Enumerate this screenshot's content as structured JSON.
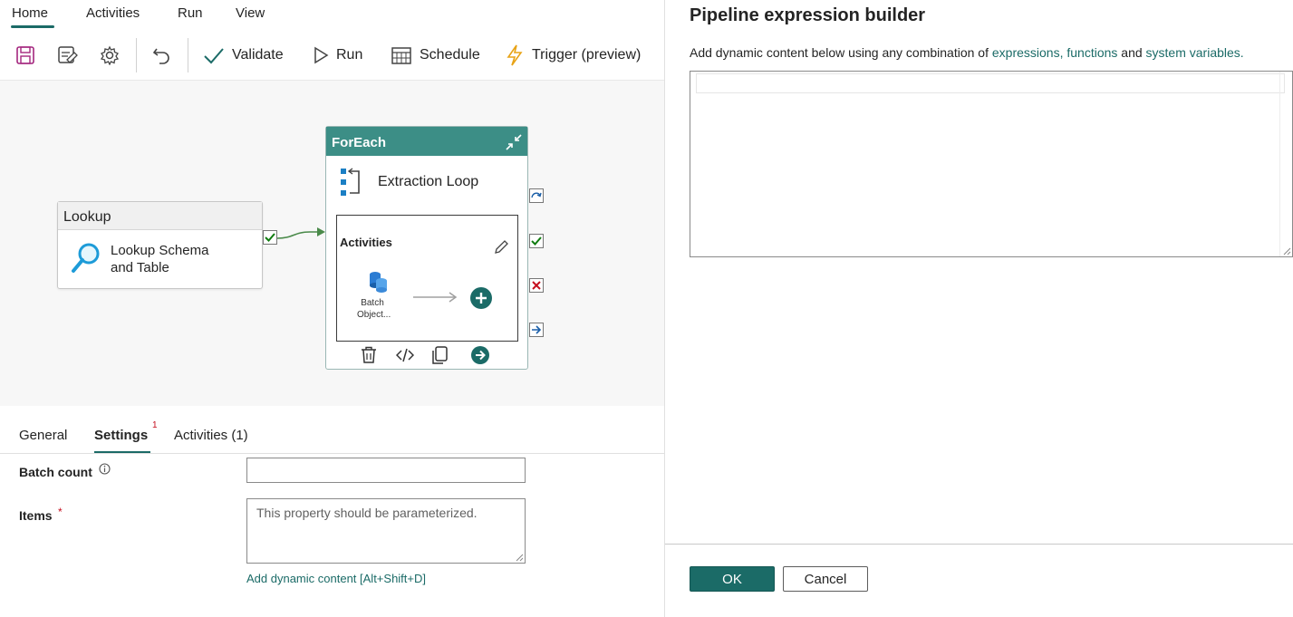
{
  "menu": {
    "home": "Home",
    "activities": "Activities",
    "run": "Run",
    "view": "View"
  },
  "toolbar": {
    "validate": "Validate",
    "run": "Run",
    "schedule": "Schedule",
    "trigger": "Trigger (preview)"
  },
  "lookup_node": {
    "header": "Lookup",
    "name": "Lookup Schema and Table"
  },
  "foreach_node": {
    "header": "ForEach",
    "name": "Extraction Loop",
    "inner_title": "Activities",
    "inner_activity": "Batch Object..."
  },
  "tabs": {
    "general": "General",
    "settings": "Settings",
    "settings_badge": "1",
    "activities": "Activities (1)"
  },
  "settings": {
    "batch_count_label": "Batch count",
    "batch_count_value": "",
    "items_label": "Items",
    "items_required": "*",
    "items_placeholder": "This property should be parameterized.",
    "dynamic_link": "Add dynamic content [Alt+Shift+D]"
  },
  "builder": {
    "title": "Pipeline expression builder",
    "desc_prefix": "Add dynamic content below using any combination of ",
    "link_expressions": "expressions,",
    "link_functions": "functions",
    "desc_and": " and ",
    "link_system_variables": "system variables.",
    "expression_value": "",
    "ok": "OK",
    "cancel": "Cancel"
  },
  "colors": {
    "accent": "#1b6b67",
    "foreach_header": "#3c8e86",
    "success": "#107c10",
    "error": "#c50f1f"
  }
}
